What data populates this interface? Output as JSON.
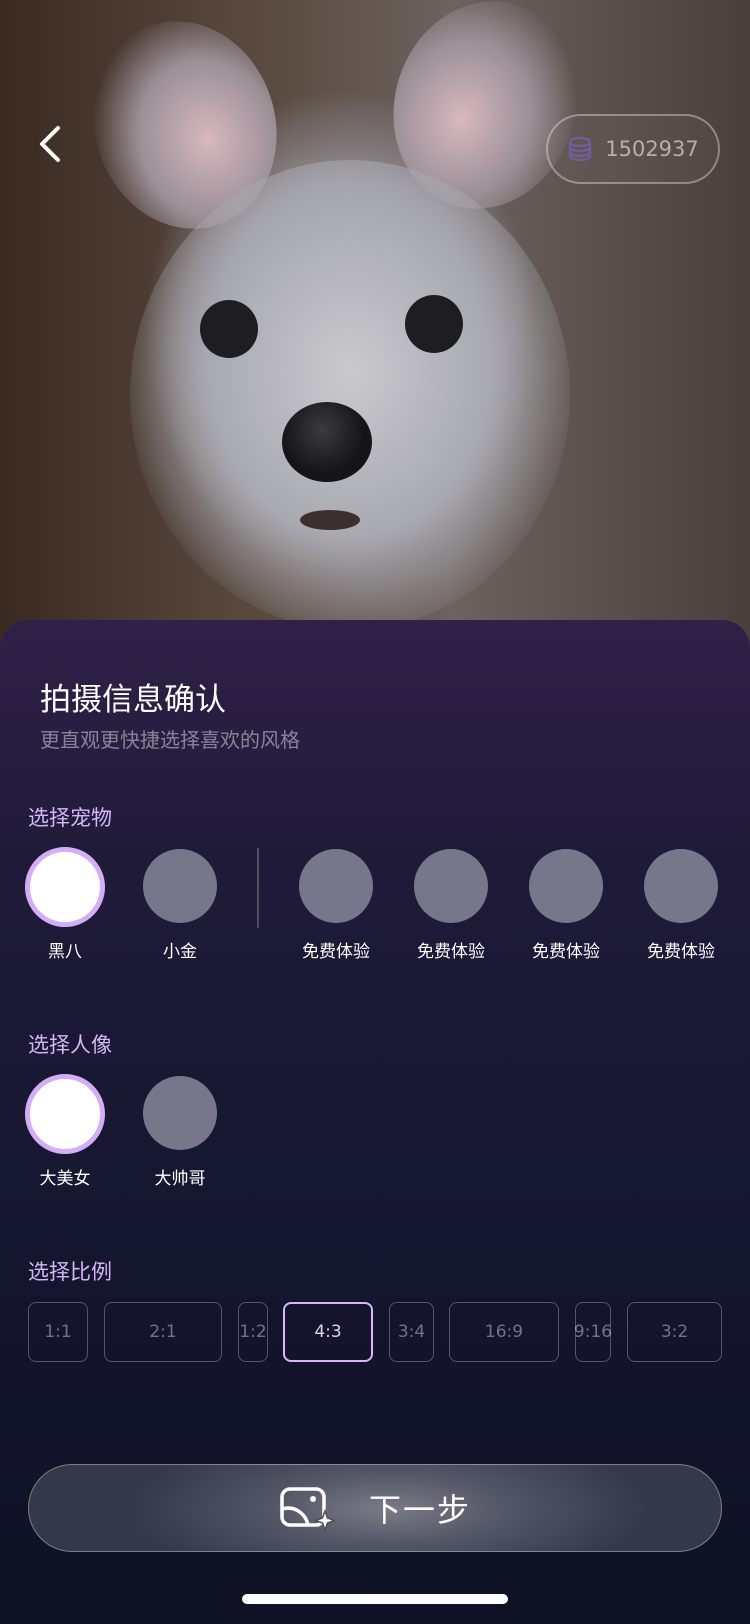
{
  "header": {
    "coin_icon": "coin-stack-icon",
    "coin_balance": "1502937"
  },
  "sheet": {
    "title": "拍摄信息确认",
    "subtitle": "更直观更快捷选择喜欢的风格"
  },
  "pets": {
    "label": "选择宠物",
    "items": [
      {
        "name": "黑八",
        "selected": true
      },
      {
        "name": "小金",
        "selected": false
      },
      {
        "name": "免费体验",
        "selected": false
      },
      {
        "name": "免费体验",
        "selected": false
      },
      {
        "name": "免费体验",
        "selected": false
      },
      {
        "name": "免费体验",
        "selected": false
      }
    ]
  },
  "portraits": {
    "label": "选择人像",
    "items": [
      {
        "name": "大美女",
        "selected": true
      },
      {
        "name": "大帅哥",
        "selected": false
      }
    ]
  },
  "ratios": {
    "label": "选择比例",
    "items": [
      "1:1",
      "2:1",
      "1:2",
      "4:3",
      "3:4",
      "16:9",
      "9:16",
      "3:2"
    ],
    "selected": "4:3"
  },
  "next_button": {
    "label": "下一步",
    "icon": "ai-image-sparkle-icon"
  },
  "colors": {
    "accent": "#d3aef6",
    "sheet_top": "#2f2148",
    "sheet_bottom": "#0f1124"
  }
}
